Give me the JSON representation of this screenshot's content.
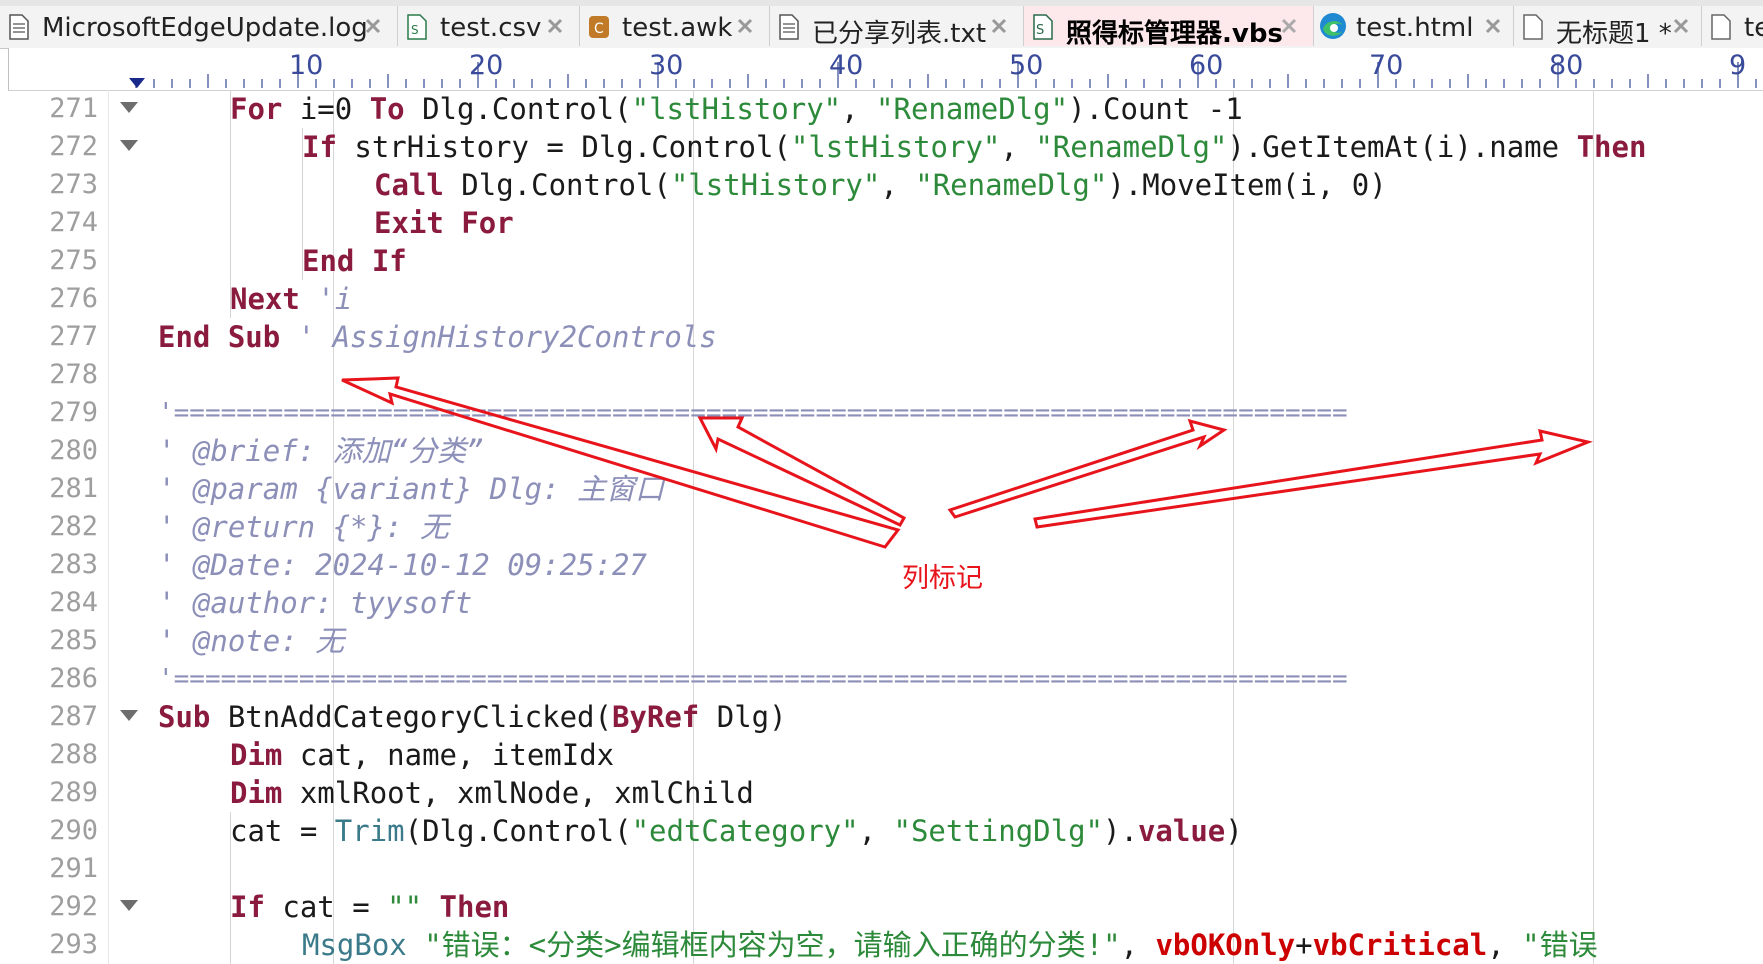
{
  "tabs": [
    {
      "label": "MicrosoftEdgeUpdate.log",
      "icon": "text-file-icon",
      "active": false
    },
    {
      "label": "test.csv",
      "icon": "csv-file-icon",
      "active": false
    },
    {
      "label": "test.awk",
      "icon": "c-file-icon",
      "active": false
    },
    {
      "label": "已分享列表.txt",
      "icon": "text-file-icon",
      "active": false
    },
    {
      "label": "照得标管理器.vbs",
      "icon": "vbs-file-icon",
      "active": true
    },
    {
      "label": "test.html",
      "icon": "edge-browser-icon",
      "active": false
    },
    {
      "label": "无标题1 *",
      "icon": "blank-file-icon",
      "active": false
    },
    {
      "label": "te",
      "icon": "blank-file-icon",
      "active": false
    }
  ],
  "ruler": {
    "labels": [
      "10",
      "20",
      "30",
      "40",
      "50",
      "60",
      "70",
      "80",
      "9"
    ]
  },
  "code": {
    "line_numbers": [
      "271",
      "272",
      "273",
      "274",
      "275",
      "276",
      "277",
      "278",
      "279",
      "280",
      "281",
      "282",
      "283",
      "284",
      "285",
      "286",
      "287",
      "288",
      "289",
      "290",
      "291",
      "292",
      "293"
    ],
    "l271": {
      "kw_for": "For",
      "t1": " i=0 ",
      "kw_to": "To",
      "t2": " Dlg.Control(",
      "s1": "\"lstHistory\"",
      "t3": ", ",
      "s2": "\"RenameDlg\"",
      "t4": ").Count -1"
    },
    "l272": {
      "kw_if": "If",
      "t1": " strHistory = Dlg.Control(",
      "s1": "\"lstHistory\"",
      "t2": ", ",
      "s2": "\"RenameDlg\"",
      "t3": ").GetItemAt(i).name ",
      "kw_then": "Then"
    },
    "l273": {
      "kw_call": "Call",
      "t1": " Dlg.Control(",
      "s1": "\"lstHistory\"",
      "t2": ", ",
      "s2": "\"RenameDlg\"",
      "t3": ").MoveItem(i, 0)"
    },
    "l274": {
      "kw": "Exit For"
    },
    "l275": {
      "kw": "End If"
    },
    "l276": {
      "kw_next": "Next",
      "cm": " 'i"
    },
    "l277": {
      "kw": "End Sub",
      "cm": " ' AssignHistory2Controls"
    },
    "l279": {
      "cm": "'==========================================================================="
    },
    "l280": {
      "cm": "' @brief: 添加“分类”"
    },
    "l281": {
      "cm": "' @param {variant} Dlg: 主窗口"
    },
    "l282": {
      "cm": "' @return {*}: 无"
    },
    "l283": {
      "cm": "' @Date: 2024-10-12 09:25:27"
    },
    "l284": {
      "cm": "' @author: tyysoft"
    },
    "l285": {
      "cm": "' @note: 无"
    },
    "l286": {
      "cm": "'==========================================================================="
    },
    "l287": {
      "kw_sub": "Sub",
      "t1": " BtnAddCategoryClicked(",
      "kw_byref": "ByRef",
      "t2": " Dlg)"
    },
    "l288": {
      "kw_dim": "Dim",
      "t1": " cat, name, itemIdx"
    },
    "l289": {
      "kw_dim": "Dim",
      "t1": " xmlRoot, xmlNode, xmlChild"
    },
    "l290": {
      "t1": "cat = ",
      "fn_trim": "Trim",
      "t2": "(Dlg.Control(",
      "s1": "\"edtCategory\"",
      "t3": ", ",
      "s2": "\"SettingDlg\"",
      "t4": ").",
      "kw_value": "value",
      "t5": ")"
    },
    "l292": {
      "kw_if": "If",
      "t1": " cat = ",
      "s1": "\"\"",
      "kw_then": " Then"
    },
    "l293": {
      "fn_msgbox": "MsgBox",
      "s1": " \"错误：<分类>编辑框内容为空，请输入正确的分类!\"",
      "t1": ", ",
      "c1": "vbOKOnly",
      "t2": "+",
      "c2": "vbCritical",
      "t3": ", ",
      "s2": "\"错误"
    }
  },
  "annotation": {
    "label": "列标记",
    "color": "#e8141c"
  },
  "colors": {
    "keyword": "#8a1a3e",
    "string": "#2c8a3a",
    "comment": "#8c8fb8",
    "active_tab": "#fde9ec"
  }
}
